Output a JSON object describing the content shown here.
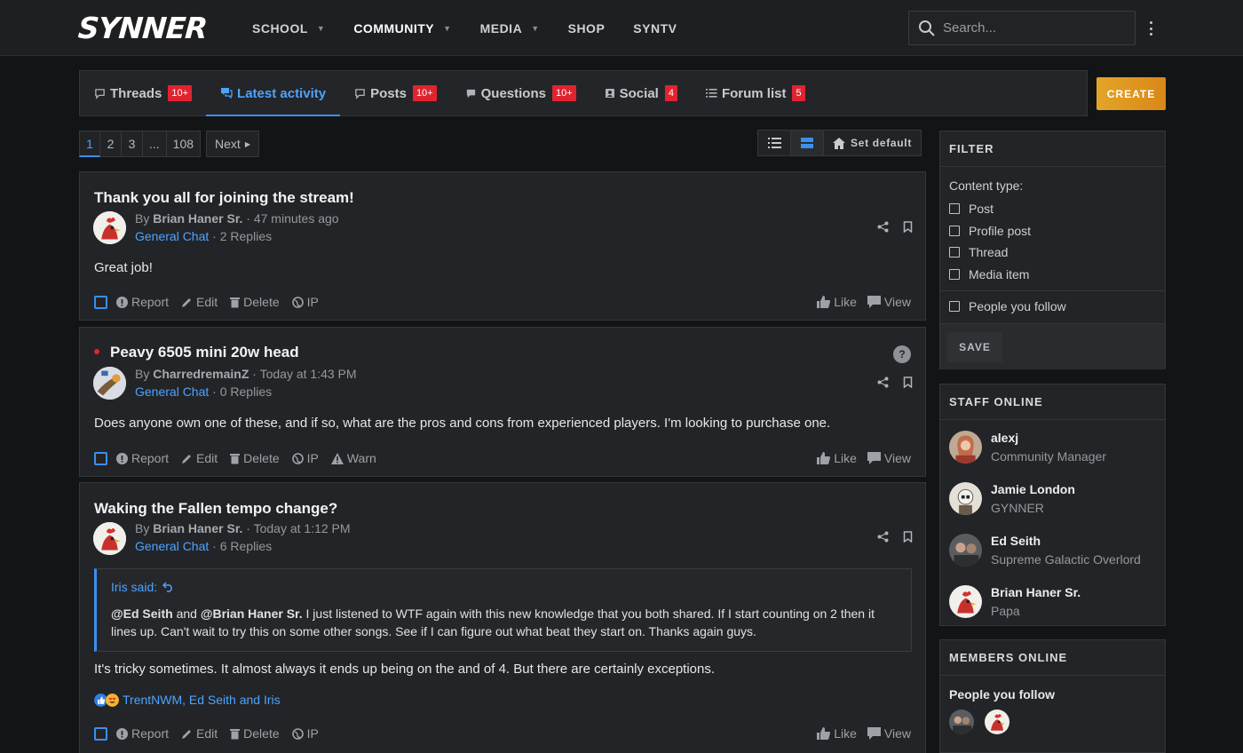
{
  "header": {
    "logo": "SYNNER",
    "nav": [
      {
        "label": "SCHOOL",
        "caret": true
      },
      {
        "label": "COMMUNITY",
        "caret": true
      },
      {
        "label": "MEDIA",
        "caret": true
      },
      {
        "label": "SHOP",
        "caret": false
      },
      {
        "label": "SYNTV",
        "caret": false
      }
    ],
    "search_placeholder": "Search..."
  },
  "tabs": [
    {
      "label": "Threads",
      "badge": "10+"
    },
    {
      "label": "Latest activity",
      "badge": ""
    },
    {
      "label": "Posts",
      "badge": "10+"
    },
    {
      "label": "Questions",
      "badge": "10+"
    },
    {
      "label": "Social",
      "badge": "4"
    },
    {
      "label": "Forum list",
      "badge": "5"
    }
  ],
  "create_label": "CREATE",
  "pagination": {
    "pages": [
      "1",
      "2",
      "3",
      "...",
      "108"
    ],
    "next": "Next"
  },
  "view": {
    "set_default": "Set default"
  },
  "posts": [
    {
      "title": "Thank you all for joining the stream!",
      "by": "By",
      "author": "Brian Haner Sr.",
      "time": "47 minutes ago",
      "forum": "General Chat",
      "replies": "2 Replies",
      "body": "Great job!",
      "actions": [
        "Report",
        "Edit",
        "Delete",
        "IP"
      ],
      "like": "Like",
      "view": "View"
    },
    {
      "title": "Peavy 6505 mini 20w head",
      "by": "By",
      "author": "CharredremainZ",
      "time": "Today at 1:43 PM",
      "forum": "General Chat",
      "replies": "0 Replies",
      "body": "Does anyone own one of these, and if so, what are the pros and cons from experienced players. I'm looking to purchase one.",
      "actions": [
        "Report",
        "Edit",
        "Delete",
        "IP",
        "Warn"
      ],
      "like": "Like",
      "view": "View"
    },
    {
      "title": "Waking the Fallen tempo change?",
      "by": "By",
      "author": "Brian Haner Sr.",
      "time": "Today at 1:12 PM",
      "forum": "General Chat",
      "replies": "6 Replies",
      "quote_author": "Iris said:",
      "quote_mention1": "@Ed Seith",
      "quote_and": "and",
      "quote_mention2": "@Brian Haner Sr.",
      "quote_text": "I just listened to WTF again with this new knowledge that you both shared. If I start counting on 2 then it lines up. Can't wait to try this on some other songs. See if I can figure out what beat they start on. Thanks again guys.",
      "body": "It's tricky sometimes. It almost always it ends up being on the and of 4. But there are certainly exceptions.",
      "reactions": "TrentNWM, Ed Seith and Iris",
      "actions": [
        "Report",
        "Edit",
        "Delete",
        "IP"
      ],
      "like": "Like",
      "view": "View"
    }
  ],
  "filter": {
    "title": "FILTER",
    "content_type": "Content type:",
    "options": [
      "Post",
      "Profile post",
      "Thread",
      "Media item"
    ],
    "follow": "People you follow",
    "save": "SAVE"
  },
  "staff_online": {
    "title": "STAFF ONLINE",
    "members": [
      {
        "name": "alexj",
        "role": "Community Manager"
      },
      {
        "name": "Jamie London",
        "role": "GYNNER"
      },
      {
        "name": "Ed Seith",
        "role": "Supreme Galactic Overlord"
      },
      {
        "name": "Brian Haner Sr.",
        "role": "Papa"
      }
    ]
  },
  "members_online": {
    "title": "MEMBERS ONLINE",
    "follow": "People you follow"
  },
  "colors": {
    "accent": "#4da3ff",
    "badge": "#e0242f",
    "create": "#e3a528",
    "bg": "#131416",
    "panel": "#232427"
  }
}
